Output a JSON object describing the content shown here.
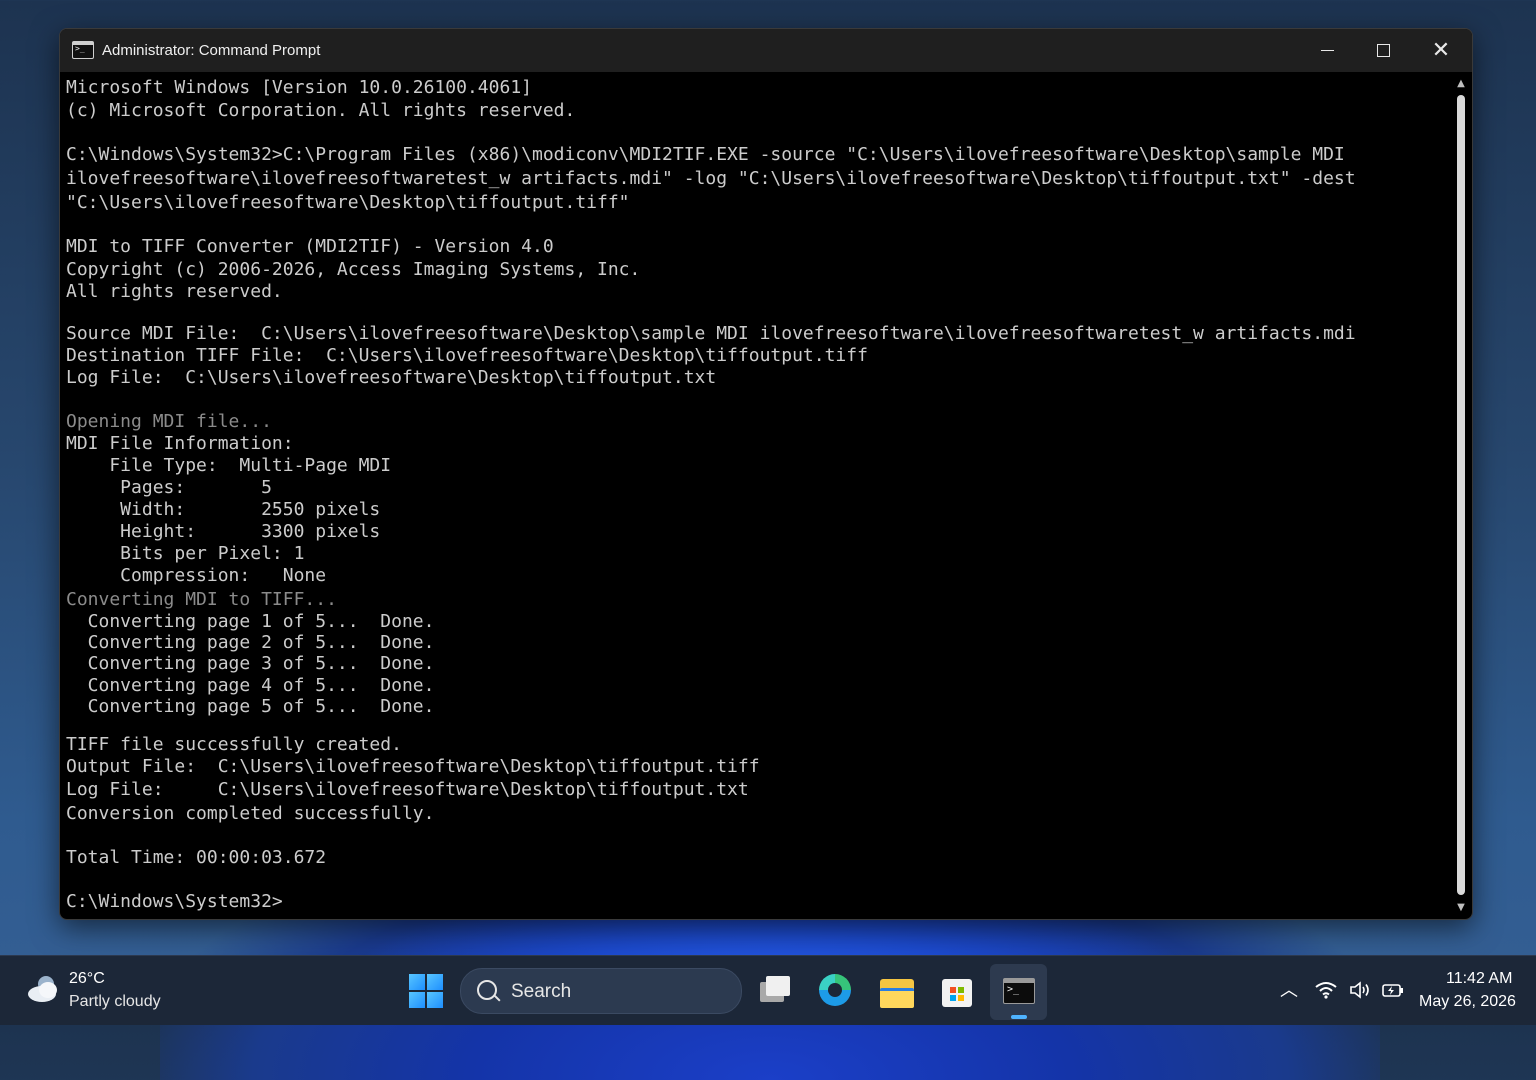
{
  "window": {
    "title": "Administrator: Command Prompt"
  },
  "console": {
    "lines": [
      {
        "t": "Microsoft Windows [Version 10.0.26100.4061]"
      },
      {
        "t": "(c) Microsoft Corporation. All rights reserved."
      },
      {
        "t": "C:\\Windows\\System32>C:\\Program Files (x86)\\modiconv\\MDI2TIF.EXE -source \"C:\\Users\\ilovefreesoftware\\Desktop\\sample MDI"
      },
      {
        "t": "ilovefreesoftware\\ilovefreesoftwaretest_w artifacts.mdi\" -log \"C:\\Users\\ilovefreesoftware\\Desktop\\tiffoutput.txt\" -dest"
      },
      {
        "t": "\"C:\\Users\\ilovefreesoftware\\Desktop\\tiffoutput.tiff\""
      },
      {
        "t": "MDI to TIFF Converter (MDI2TIF) - Version 4.0"
      },
      {
        "t": "Copyright (c) 2006-2026, Access Imaging Systems, Inc."
      },
      {
        "t": "All rights reserved."
      },
      {
        "t": "Source MDI File:  C:\\Users\\ilovefreesoftware\\Desktop\\sample MDI ilovefreesoftware\\ilovefreesoftwaretest_w artifacts.mdi"
      },
      {
        "t": "Destination TIFF File:  C:\\Users\\ilovefreesoftware\\Desktop\\tiffoutput.tiff"
      },
      {
        "t": "Log File:  C:\\Users\\ilovefreesoftware\\Desktop\\tiffoutput.txt"
      },
      {
        "t": "Opening MDI file..."
      },
      {
        "t": "MDI File Information:"
      },
      {
        "t": "    File Type:  Multi-Page MDI"
      },
      {
        "t": "     Pages:       5"
      },
      {
        "t": "     Width:       2550 pixels"
      },
      {
        "t": "     Height:      3300 pixels"
      },
      {
        "t": "     Bits per Pixel: 1"
      },
      {
        "t": "     Compression:   None"
      },
      {
        "t": "Converting MDI to TIFF..."
      },
      {
        "t": "  Converting page 1 of 5...  Done."
      },
      {
        "t": "  Converting page 2 of 5...  Done."
      },
      {
        "t": "  Converting page 3 of 5...  Done."
      },
      {
        "t": "  Converting page 4 of 5...  Done."
      },
      {
        "t": "  Converting page 5 of 5...  Done."
      },
      {
        "t": "TIFF file successfully created."
      },
      {
        "t": "Output File:  C:\\Users\\ilovefreesoftware\\Desktop\\tiffoutput.tiff"
      },
      {
        "t": "Log File:     C:\\Users\\ilovefreesoftware\\Desktop\\tiffoutput.txt"
      },
      {
        "t": "Conversion completed successfully."
      },
      {
        "t": "Total Time: 00:00:03.672"
      },
      {
        "t": "C:\\Windows\\System32>"
      }
    ]
  },
  "taskbar": {
    "weather_temp": "26°C",
    "weather_desc": "Partly cloudy",
    "search_label": "Search",
    "clock_time": "11:42 AM",
    "clock_date": "May 26, 2026"
  },
  "colors": {
    "console_text": "#cccccc",
    "console_dim": "#8b8b8b",
    "accent": "#4fb3ff"
  }
}
